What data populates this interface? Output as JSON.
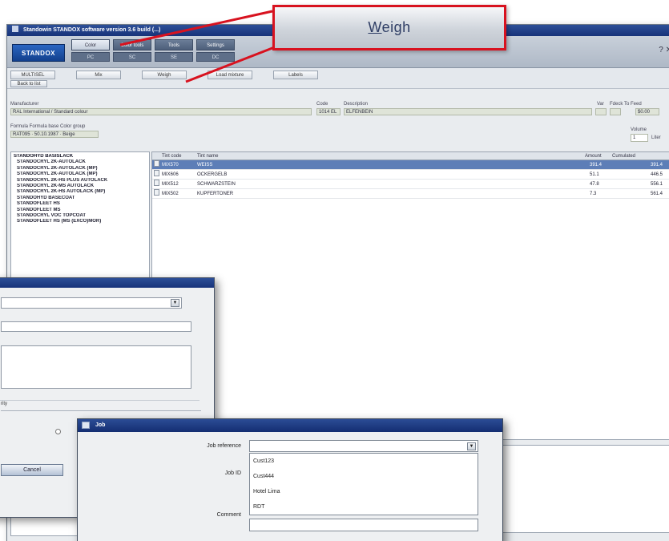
{
  "callout": {
    "label": "Weigh",
    "mnemonic": "W"
  },
  "main_window": {
    "title": "Standowin STANDOX software version 3.6 build (...)",
    "logo": "STANDOX",
    "main_tabs": [
      "Color",
      "Color tools",
      "Tools",
      "Settings"
    ],
    "sub_tabs": [
      "PC",
      "SC",
      "SE",
      "DC"
    ],
    "top_right_icons": "? ✕",
    "toolbar_buttons": [
      "MULTISEL",
      "Mix",
      "Weigh",
      "Load mixture",
      "Labels"
    ],
    "toolbar_button_small": "Back to list",
    "manufacturer_label": "Manufacturer",
    "manufacturer_value": "RAL International / Standard colour",
    "code_label": "Code",
    "code_value": "1014 EL",
    "description_label": "Description",
    "description_value": "ELFENBEIN",
    "var_label": "Var",
    "fdeck_label": "Fdeck",
    "tofeed_label": "To Feed",
    "tofeed_value": "$0.00",
    "formula_label": "Formula Formula base Color group",
    "formula_values": "RAT095 · 50.10.1987 · Beige",
    "volume_label": "Volume",
    "volume_value": "1",
    "volume_unit": "Liter"
  },
  "tree": {
    "root": "STANDOHYD BASISLACK",
    "items": [
      "STANDOCRYL 2K-AUTOLACK",
      "STANDOCRYL 2K-AUTOLACK (MP)",
      "STANDOCRYL 2K-AUTOLACK (MP)",
      "STANDOCRYL 2K-HS PLUS AUTOLACK",
      "STANDOCRYL 2K-MS AUTOLACK",
      "STANDOCRYL 2K-HS AUTOLACK (MP)",
      "STANDOHYD BASECOAT",
      "STANDOFLEET HS",
      "STANDOFLEET MS",
      "STANDOCRYL VOC TOPCOAT",
      "STANDOFLEET HS (MS (EXCO)MOR)"
    ]
  },
  "grid": {
    "headers": [
      "Tint code",
      "Tint name",
      "Amount",
      "Cumulated"
    ],
    "rows": [
      {
        "code": "MIX570",
        "name": "WEISS",
        "amount": "391.4",
        "cumulated": "391.4"
      },
      {
        "code": "MIX606",
        "name": "OCKERGELB",
        "amount": "51.1",
        "cumulated": "446.5"
      },
      {
        "code": "MIX512",
        "name": "SCHWARZSTEIN",
        "amount": "47.8",
        "cumulated": "556.1"
      },
      {
        "code": "MIX502",
        "name": "KUPFERTONER",
        "amount": "7.3",
        "cumulated": "561.4"
      }
    ]
  },
  "left_dialog": {
    "checkbox_fragment": "rity",
    "cancel_label": "Cancel"
  },
  "job_dialog": {
    "title": "Job",
    "job_reference_label": "Job reference",
    "job_id_label": "Job ID",
    "comment_label": "Comment",
    "options": [
      "Cust123",
      "Cust444",
      "Hotel Lima",
      "RDT"
    ]
  },
  "colors": {
    "callout_border": "#d8121f",
    "titlebar": "#17337a",
    "selected_row": "#5d7eb7",
    "delete_marker": "#e0141d"
  }
}
